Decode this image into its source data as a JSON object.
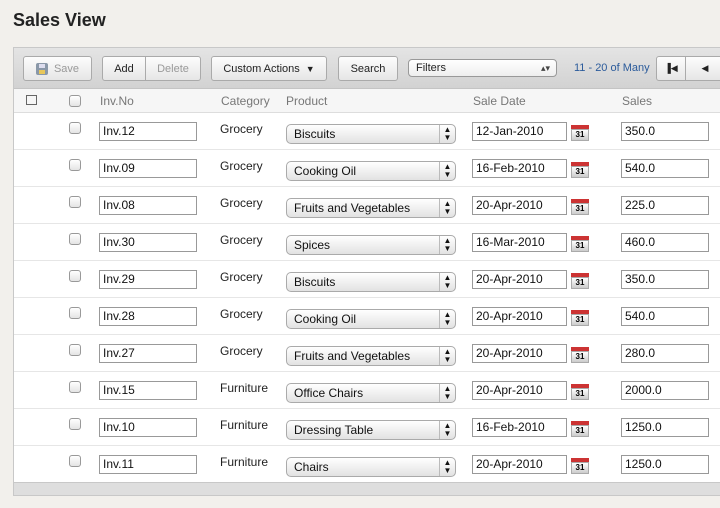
{
  "title": "Sales View",
  "toolbar": {
    "save": "Save",
    "add": "Add",
    "delete": "Delete",
    "custom_actions": "Custom Actions",
    "search": "Search",
    "filters": "Filters",
    "pager": "11 - 20 of Many"
  },
  "columns": {
    "inv": "Inv.No",
    "category": "Category",
    "product": "Product",
    "date": "Sale Date",
    "sales": "Sales"
  },
  "rows": [
    {
      "inv": "Inv.12",
      "category": "Grocery",
      "product": "Biscuits",
      "date": "12-Jan-2010",
      "sales": "350.0"
    },
    {
      "inv": "Inv.09",
      "category": "Grocery",
      "product": "Cooking Oil",
      "date": "16-Feb-2010",
      "sales": "540.0"
    },
    {
      "inv": "Inv.08",
      "category": "Grocery",
      "product": "Fruits and Vegetables",
      "date": "20-Apr-2010",
      "sales": "225.0"
    },
    {
      "inv": "Inv.30",
      "category": "Grocery",
      "product": "Spices",
      "date": "16-Mar-2010",
      "sales": "460.0"
    },
    {
      "inv": "Inv.29",
      "category": "Grocery",
      "product": "Biscuits",
      "date": "20-Apr-2010",
      "sales": "350.0"
    },
    {
      "inv": "Inv.28",
      "category": "Grocery",
      "product": "Cooking Oil",
      "date": "20-Apr-2010",
      "sales": "540.0"
    },
    {
      "inv": "Inv.27",
      "category": "Grocery",
      "product": "Fruits and Vegetables",
      "date": "20-Apr-2010",
      "sales": "280.0"
    },
    {
      "inv": "Inv.15",
      "category": "Furniture",
      "product": "Office Chairs",
      "date": "20-Apr-2010",
      "sales": "2000.0"
    },
    {
      "inv": "Inv.10",
      "category": "Furniture",
      "product": "Dressing Table",
      "date": "16-Feb-2010",
      "sales": "1250.0"
    },
    {
      "inv": "Inv.11",
      "category": "Furniture",
      "product": "Chairs",
      "date": "20-Apr-2010",
      "sales": "1250.0"
    }
  ],
  "calendar_day": "31"
}
